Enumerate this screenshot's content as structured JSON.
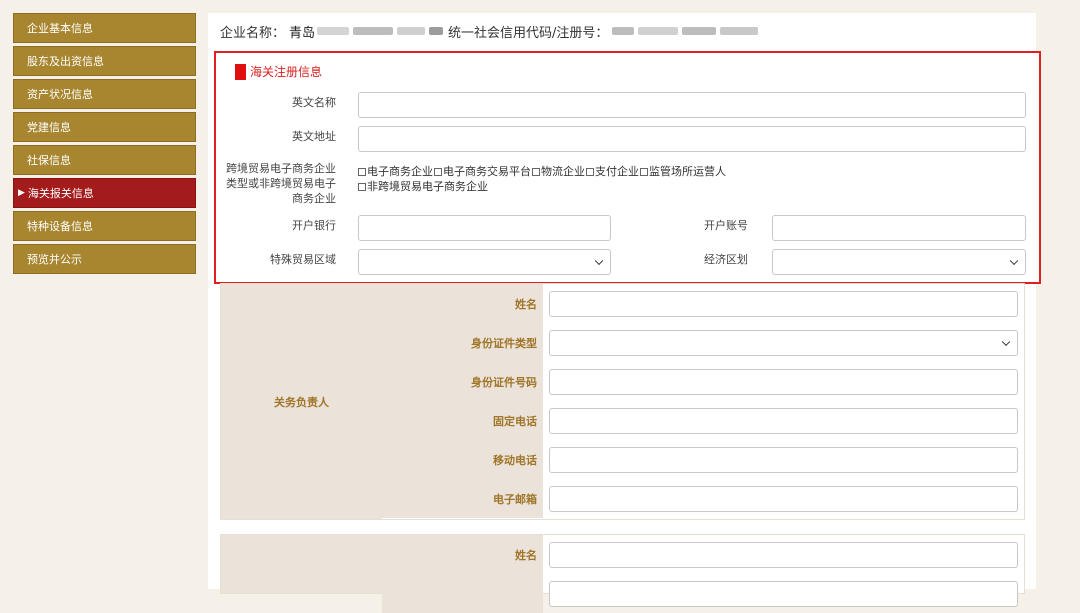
{
  "sidebar": {
    "items": [
      {
        "label": "企业基本信息"
      },
      {
        "label": "股东及出资信息"
      },
      {
        "label": "资产状况信息"
      },
      {
        "label": "党建信息"
      },
      {
        "label": "社保信息"
      },
      {
        "label": "海关报关信息",
        "active": true
      },
      {
        "label": "特种设备信息"
      },
      {
        "label": "预览并公示"
      }
    ],
    "active_marker": "▶"
  },
  "header": {
    "company_label": "企业名称：",
    "company_name": "青岛",
    "credit_label": "统一社会信用代码/注册号："
  },
  "customs": {
    "title": "海关注册信息",
    "english_name_label": "英文名称",
    "english_address_label": "英文地址",
    "cross_border_label_1": "跨境贸易电子商务企业",
    "cross_border_label_2": "类型或非跨境贸易电子",
    "cross_border_label_3": "商务企业",
    "options": [
      "电子商务企业",
      "电子商务交易平台",
      "物流企业",
      "支付企业",
      "监管场所运营人"
    ],
    "option_non": "非跨境贸易电子商务企业",
    "bank_label": "开户银行",
    "account_label": "开户账号",
    "special_zone_label": "特殊贸易区域",
    "economic_zone_label": "经济区划"
  },
  "contact1": {
    "group_label": "关务负责人",
    "fields": [
      "姓名",
      "身份证件类型",
      "身份证件号码",
      "固定电话",
      "移动电话",
      "电子邮箱"
    ]
  },
  "contact2": {
    "fields": [
      "姓名"
    ]
  }
}
